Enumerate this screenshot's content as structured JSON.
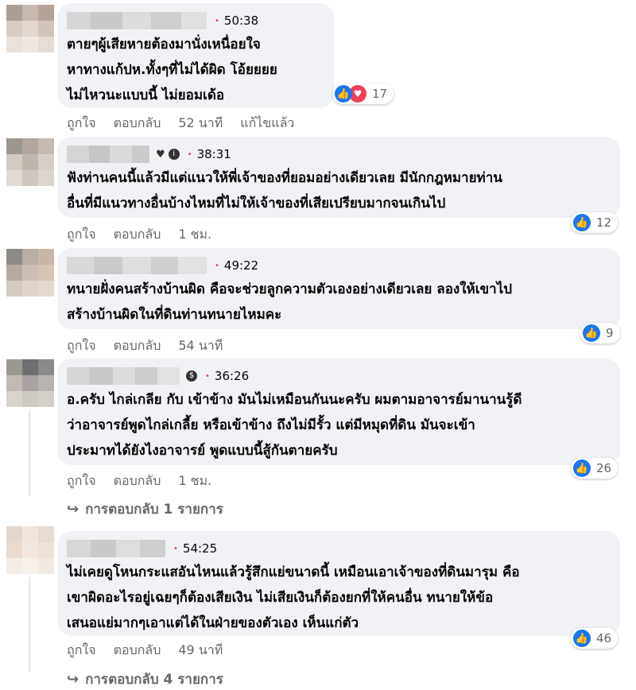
{
  "comments": [
    {
      "time": "50:38",
      "text": "ตายๆผู้เสียหายต้องมานั่งเหนื่อยใจ\nหาทางแก้ปห.ทั้งๆที่ไม่ได้ผิด โอ้ยยยย\nไม่ไหวนะแบบนี้ ไม่ยอมเด้อ",
      "reaction_count": "17",
      "actions": {
        "like": "ถูกใจ",
        "reply": "ตอบกลับ",
        "age": "52 นาที",
        "edited": "แก้ไขแล้ว"
      }
    },
    {
      "time": "38:31",
      "text": "ฟังท่านคนนี้แล้วมีแต่แนวให้พี่เจ้าของที่ยอมอย่างเดียวเลย มีนักกฎหมายท่าน\nอื่นที่มีแนวทางอื่นบ้างไหมที่ไม่ให้เจ้าของที่เสียเปรียบมากจนเกินไป",
      "reaction_count": "12",
      "actions": {
        "like": "ถูกใจ",
        "reply": "ตอบกลับ",
        "age": "1 ชม."
      }
    },
    {
      "time": "49:22",
      "text": "ทนายฝั่งคนสร้างบ้านผิด คือจะช่วยลูกความตัวเองอย่างเดียวเลย ลองให้เขาไป\nสร้างบ้านผิดในที่ดินท่านทนายไหมคะ",
      "reaction_count": "9",
      "actions": {
        "like": "ถูกใจ",
        "reply": "ตอบกลับ",
        "age": "54 นาที"
      }
    },
    {
      "time": "36:26",
      "text": "อ.ครับ ไกล่เกลีย กับ เข้าข้าง มันไม่เหมือนกันนะครับ ผมตามอาจารย์มานานรู้ดี\nว่าอาจารย์พูดไกล่เกลี้ย หรือเข้าข้าง ถึงไม่มีรั้ว แต่มีหมุดที่ดิน มันจะเข้า\nประมาทได้ยังไงอาจารย์ พูดแบบนี้สู้กันตายครับ",
      "reaction_count": "26",
      "actions": {
        "like": "ถูกใจ",
        "reply": "ตอบกลับ",
        "age": "1 ชม."
      },
      "replies_link": "การตอบกลับ 1 รายการ"
    },
    {
      "time": "54:25",
      "text": "ไม่เคยดูโหนกระแสอันไหนแล้วรู้สึกแย่ขนาดนี้ เหมือนเอาเจ้าของที่ดินมารุม คือ\nเขาผิดอะไรอยู่เฉยๆก็ต้องเสียเงิน ไม่เสียเงินก็ต้องยกที่ให้คนอื่น ทนายให้ข้อ\nเสนอแย่มากๆเอาแต่ได้ในฝ่ายของตัวเอง เห็นแก่ตัว",
      "reaction_count": "46",
      "actions": {
        "like": "ถูกใจ",
        "reply": "ตอบกลับ",
        "age": "49 นาที"
      },
      "replies_link": "การตอบกลับ 4 รายการ"
    }
  ],
  "colors": {
    "like": "#1877f2",
    "love": "#f33e58",
    "bubble": "#f0f2f5",
    "meta": "#65676b"
  }
}
